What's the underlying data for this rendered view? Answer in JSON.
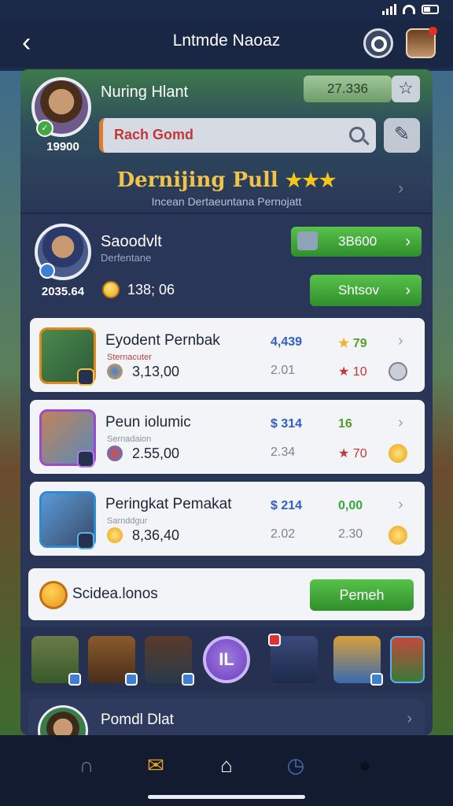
{
  "header": {
    "title": "Lntmde Naoaz"
  },
  "profile": {
    "name": "Nuring Hlant",
    "score": "19900",
    "coins": "27.336",
    "search_value": "Rach Gomd"
  },
  "section": {
    "title": "Dernijing Pull",
    "stars": "★★★",
    "subtitle": "Incean Dertaeuntana Pernojatt"
  },
  "player": {
    "name": "Saoodvlt",
    "subtitle": "Derfentane",
    "score": "2035.64",
    "coins": "138; 06",
    "btn_primary": "3B600",
    "btn_secondary": "Shtsov"
  },
  "items": [
    {
      "title": "Eyodent Pernbak",
      "sub": "Sternacuter",
      "price": "3,13,00",
      "v1": "4,439",
      "v2": "2.01",
      "v3": "79",
      "v4": "10"
    },
    {
      "title": "Peun iolumic",
      "sub": "Sernadaion",
      "price": "2.55,00",
      "v1": "$ 314",
      "v2": "2.34",
      "v3": "16",
      "v4": "70"
    },
    {
      "title": "Peringkat Pemakat",
      "sub": "Sarnddgur",
      "price": "8,36,40",
      "v1": "$ 214",
      "v2": "2.02",
      "v3": "0,00",
      "v4": "2.30"
    }
  ],
  "promo": {
    "text": "Scidea.lonos",
    "button": "Pemeh"
  },
  "center_button": {
    "label": "IL"
  },
  "bottom": {
    "title": "Pomdl Dlat"
  },
  "colors": {
    "accent_green": "#3aa63a",
    "panel": "#2a3657",
    "gold": "#f2c34a"
  },
  "icons": {
    "tabs": [
      "headset-icon",
      "mail-icon",
      "bag-icon",
      "clock-icon",
      "profile-icon"
    ]
  }
}
